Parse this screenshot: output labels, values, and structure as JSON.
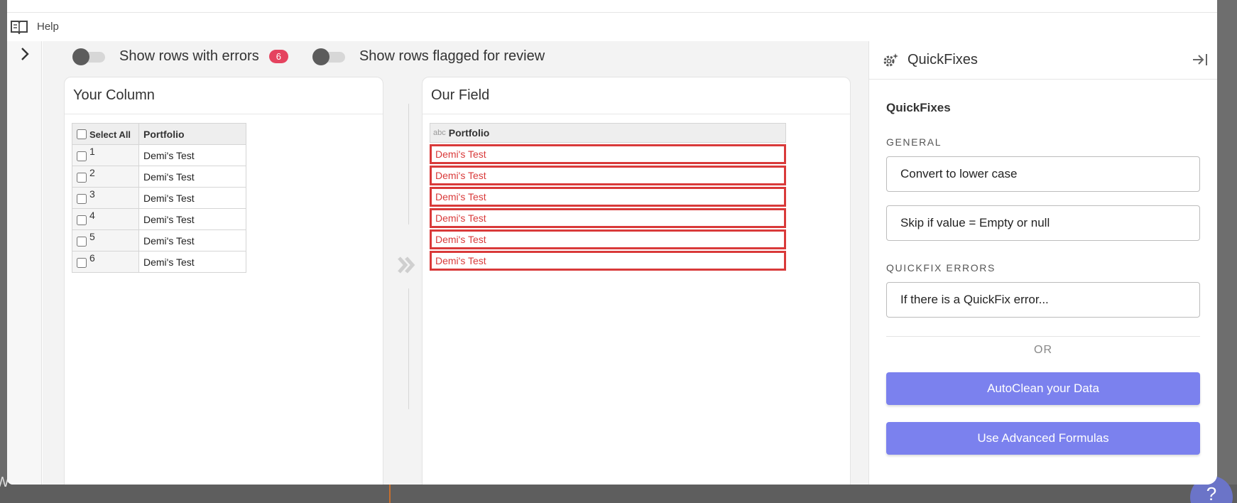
{
  "help": {
    "label": "Help"
  },
  "toggles": {
    "errors_label": "Show rows with errors",
    "errors_count": "6",
    "flagged_label": "Show rows flagged for review"
  },
  "your_column": {
    "title": "Your Column",
    "select_all": "Select All",
    "header": "Portfolio",
    "rows": [
      {
        "num": "1",
        "value": "Demi's Test"
      },
      {
        "num": "2",
        "value": "Demi's Test"
      },
      {
        "num": "3",
        "value": "Demi's Test"
      },
      {
        "num": "4",
        "value": "Demi's Test"
      },
      {
        "num": "5",
        "value": "Demi's Test"
      },
      {
        "num": "6",
        "value": "Demi's Test"
      }
    ]
  },
  "our_field": {
    "title": "Our Field",
    "header": "Portfolio",
    "type_glyph": "abc",
    "rows": [
      "Demi's Test",
      "Demi's Test",
      "Demi's Test",
      "Demi's Test",
      "Demi's Test",
      "Demi's Test"
    ]
  },
  "quickfixes": {
    "panel_title": "QuickFixes",
    "subtitle": "QuickFixes",
    "general_label": "GENERAL",
    "general_items": [
      "Convert to lower case",
      "Skip if value = Empty or null"
    ],
    "errors_label": "QUICKFIX ERRORS",
    "errors_item": "If there is a QuickFix error...",
    "or_label": "OR",
    "autoclean_label": "AutoClean your Data",
    "advanced_label": "Use Advanced Formulas"
  },
  "colors": {
    "error_red": "#d93a3a",
    "badge_red": "#e5435f",
    "accent_purple": "#7b81ee"
  }
}
